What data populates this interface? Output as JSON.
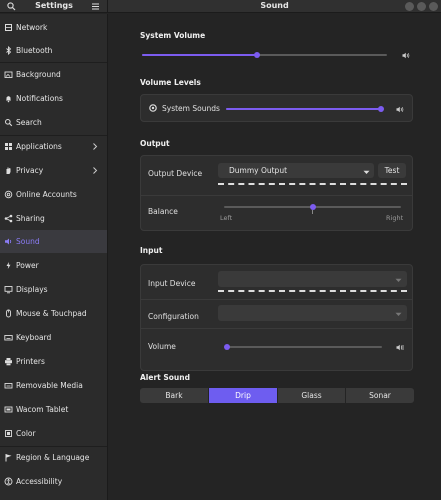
{
  "header": {
    "sidebar_title": "Settings",
    "main_title": "Sound"
  },
  "sidebar": {
    "items": [
      {
        "label": "Network",
        "icon": "network-icon"
      },
      {
        "label": "Bluetooth",
        "icon": "bluetooth-icon"
      },
      {
        "label": "Background",
        "icon": "background-icon"
      },
      {
        "label": "Notifications",
        "icon": "bell-icon"
      },
      {
        "label": "Search",
        "icon": "search-icon"
      },
      {
        "label": "Applications",
        "icon": "grid-icon"
      },
      {
        "label": "Privacy",
        "icon": "hand-icon"
      },
      {
        "label": "Online Accounts",
        "icon": "at-icon"
      },
      {
        "label": "Sharing",
        "icon": "share-icon"
      },
      {
        "label": "Sound",
        "icon": "speaker-icon"
      },
      {
        "label": "Power",
        "icon": "power-icon"
      },
      {
        "label": "Displays",
        "icon": "display-icon"
      },
      {
        "label": "Mouse & Touchpad",
        "icon": "mouse-icon"
      },
      {
        "label": "Keyboard",
        "icon": "keyboard-icon"
      },
      {
        "label": "Printers",
        "icon": "printer-icon"
      },
      {
        "label": "Removable Media",
        "icon": "media-icon"
      },
      {
        "label": "Wacom Tablet",
        "icon": "tablet-icon"
      },
      {
        "label": "Color",
        "icon": "color-icon"
      },
      {
        "label": "Region & Language",
        "icon": "flag-icon"
      },
      {
        "label": "Accessibility",
        "icon": "accessibility-icon"
      }
    ],
    "active": "Sound"
  },
  "system_volume": {
    "title": "System Volume",
    "level": 0.47
  },
  "volume_levels": {
    "title": "Volume Levels",
    "system_sounds_label": "System Sounds",
    "level": 1.0
  },
  "output": {
    "title": "Output",
    "device_label": "Output Device",
    "device_value": "Dummy Output",
    "test_label": "Test",
    "balance_label": "Balance",
    "balance_left": "Left",
    "balance_right": "Right",
    "balance_level": 0.5
  },
  "input": {
    "title": "Input",
    "device_label": "Input Device",
    "device_value": "",
    "configuration_label": "Configuration",
    "configuration_value": "",
    "volume_label": "Volume",
    "volume_level": 0.0
  },
  "alert_sound": {
    "title": "Alert Sound",
    "options": [
      "Bark",
      "Drip",
      "Glass",
      "Sonar"
    ],
    "selected": "Drip"
  },
  "colors": {
    "accent": "#7c5cf0",
    "sidebar_active_text": "#8b7cf6"
  }
}
